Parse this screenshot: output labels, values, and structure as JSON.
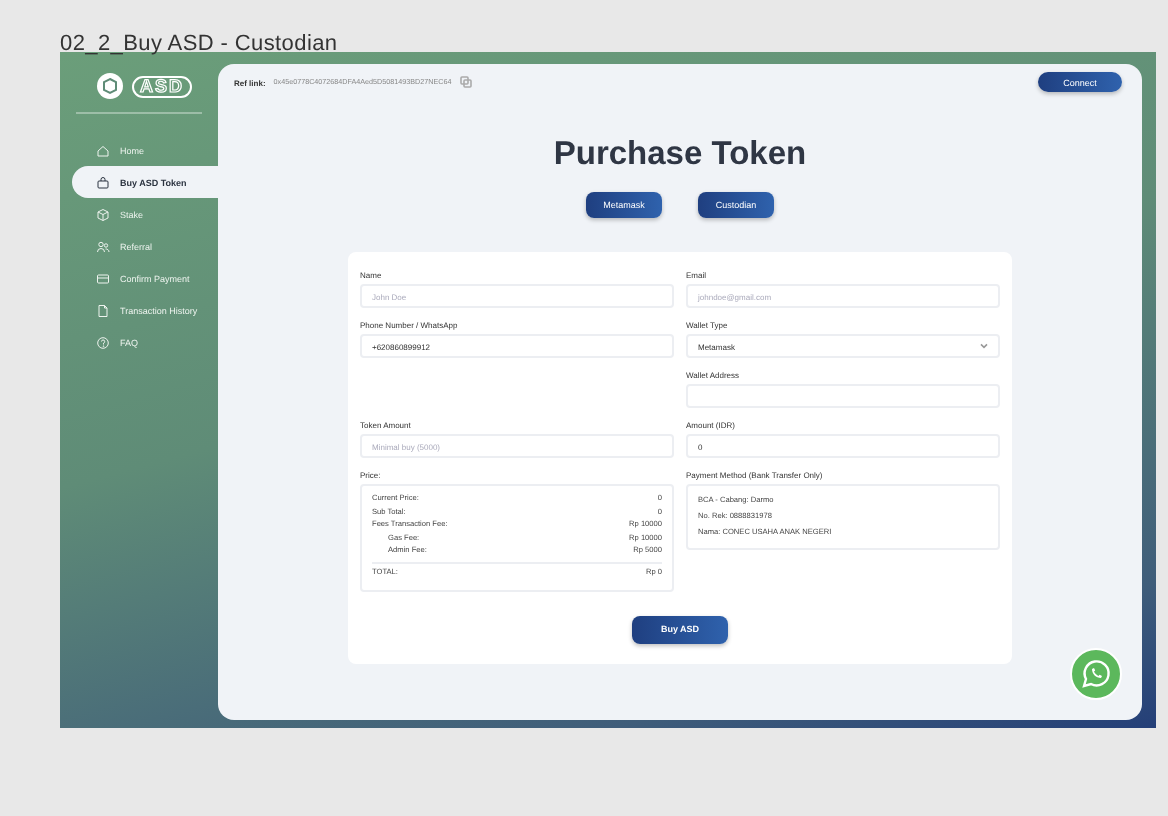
{
  "canvas": {
    "title": "02_2_Buy ASD - Custodian"
  },
  "logo": {
    "text": "ASD"
  },
  "sidebar": {
    "items": [
      {
        "label": "Home",
        "kind": "home",
        "selected": false
      },
      {
        "label": "Buy ASD Token",
        "kind": "bag",
        "selected": true
      },
      {
        "label": "Stake",
        "kind": "cube",
        "selected": false
      },
      {
        "label": "Referral",
        "kind": "people",
        "selected": false
      },
      {
        "label": "Confirm Payment",
        "kind": "card",
        "selected": false
      },
      {
        "label": "Transaction History",
        "kind": "doc",
        "selected": false
      },
      {
        "label": "FAQ",
        "kind": "help",
        "selected": false
      }
    ]
  },
  "header": {
    "ref_label": "Ref link:",
    "ref_value": "0x45e0778C4072684DFA4Aed5D5081493BD27NEC64",
    "connect": "Connect"
  },
  "page_title": "Purchase Token",
  "mode_buttons": [
    "Metamask",
    "Custodian"
  ],
  "form": {
    "left": [
      {
        "kind": "input",
        "label": "Name",
        "placeholder": "John Doe"
      },
      {
        "kind": "input",
        "label": "Phone Number / WhatsApp",
        "value": "+620860899912"
      },
      {
        "kind": "spacer"
      },
      {
        "kind": "input",
        "label": "Token Amount",
        "placeholder": "Minimal buy (5000)"
      }
    ],
    "right": [
      {
        "kind": "input",
        "label": "Email",
        "placeholder": "johndoe@gmail.com"
      },
      {
        "kind": "select",
        "label": "Wallet Type",
        "value": "Metamask"
      },
      {
        "kind": "input",
        "label": "Wallet Address"
      },
      {
        "kind": "input",
        "label": "Amount (IDR)",
        "value": "0"
      }
    ],
    "price": {
      "label": "Price:",
      "rows": [
        {
          "kind": "row",
          "label": "Current Price:",
          "value": "0"
        },
        {
          "kind": "row",
          "label": "Sub Total:",
          "value": "0"
        },
        {
          "kind": "row",
          "label": "Fees Transaction Fee:",
          "value": "Rp 10000"
        },
        {
          "kind": "indent",
          "label": "Gas Fee:",
          "value": "Rp 10000"
        },
        {
          "kind": "indent",
          "label": "Admin Fee:",
          "value": "Rp 5000"
        },
        {
          "kind": "total",
          "label": "TOTAL:",
          "value": "Rp 0"
        }
      ]
    },
    "payment": {
      "label": "Payment Method (Bank Transfer Only)",
      "lines": [
        "BCA - Cabang: Darmo",
        "No. Rek: 0888831978",
        "Nama: CONEC USAHA ANAK NEGERI"
      ]
    },
    "submit": "Buy ASD"
  }
}
